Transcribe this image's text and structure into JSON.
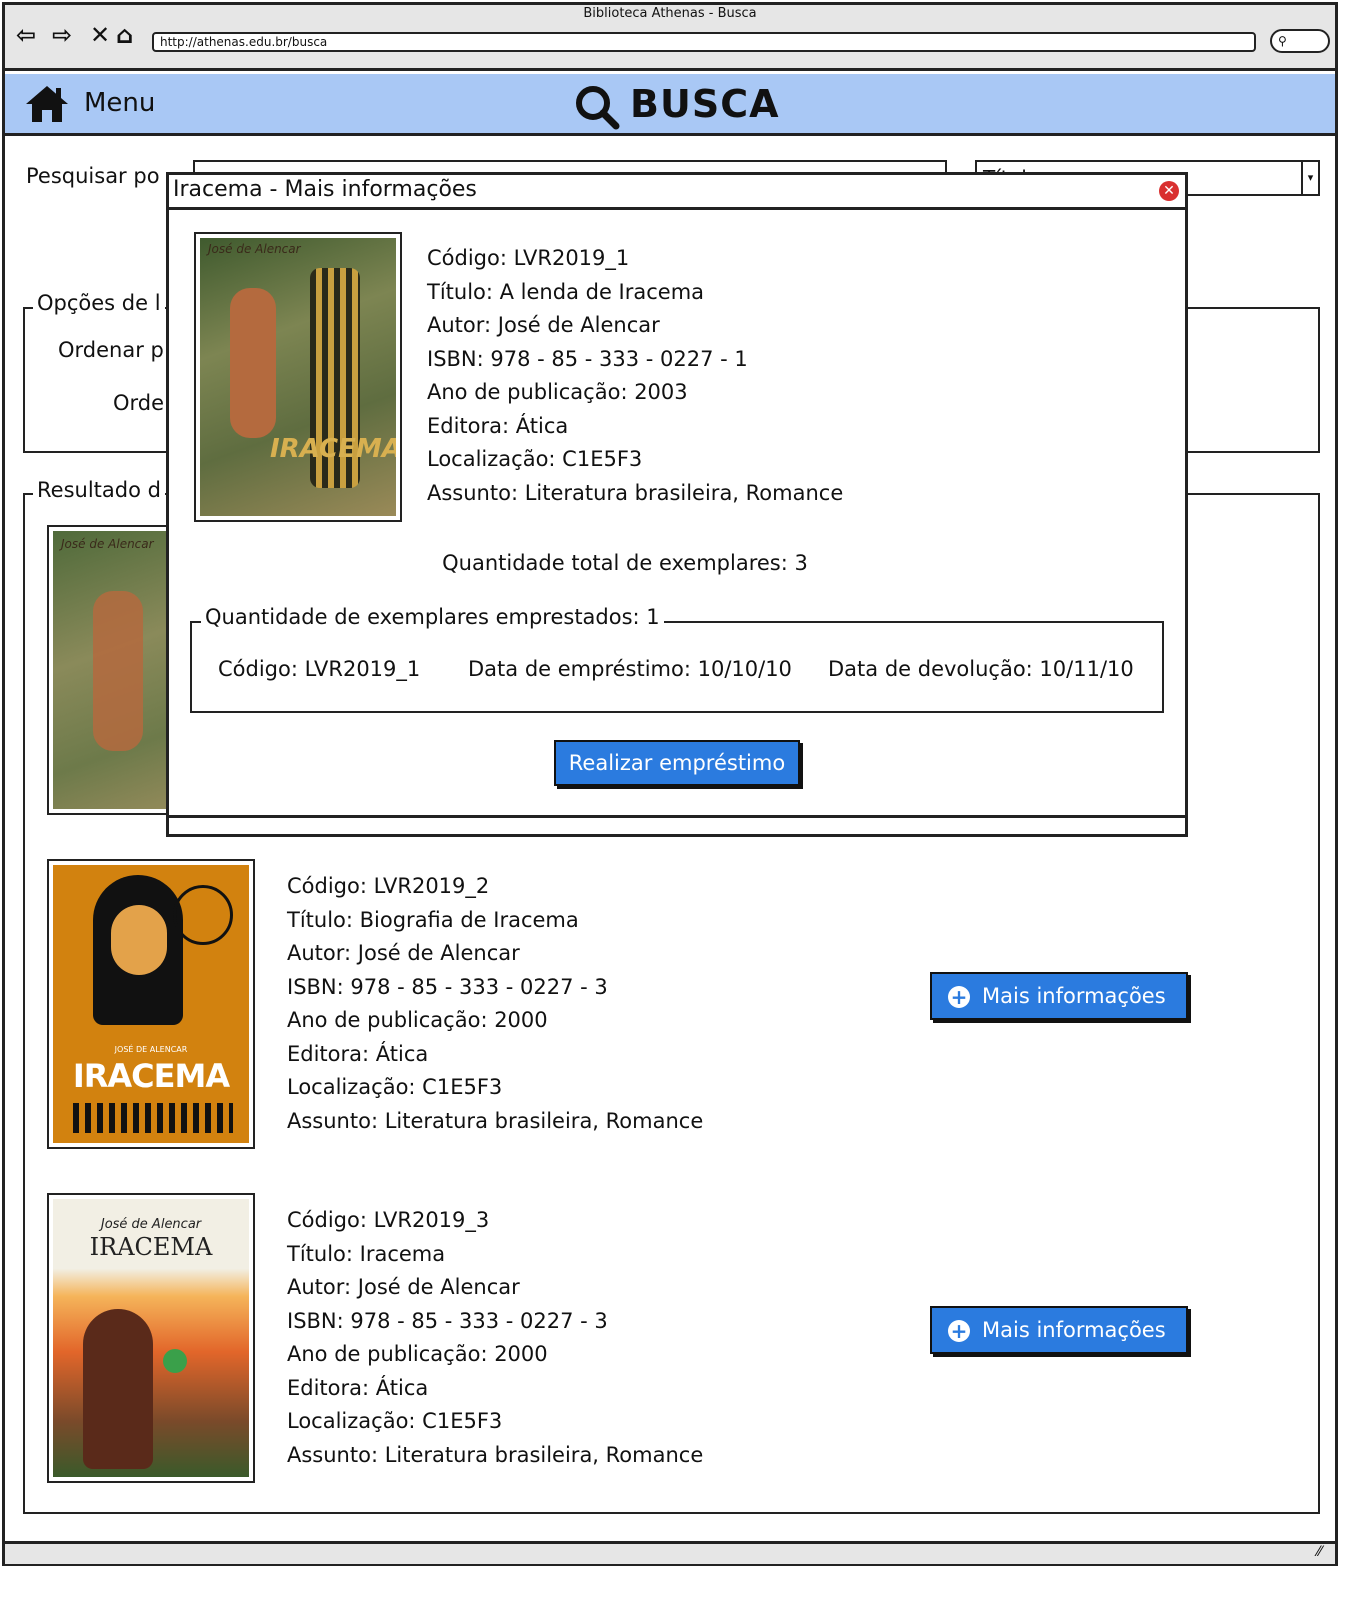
{
  "window": {
    "title": "Biblioteca Athenas - Busca",
    "url": "http://athenas.edu.br/busca"
  },
  "header": {
    "menu_label": "Menu",
    "title": "BUSCA"
  },
  "search": {
    "label": "Pesquisar po",
    "type_value": "Títul"
  },
  "options": {
    "legend": "Opções de l",
    "order_by": "Ordenar p",
    "order": "Orde"
  },
  "results": {
    "legend": "Resultado d",
    "items": [
      {
        "fields": [
          "Código: LVR2019_2",
          "Título: Biografia de Iracema",
          "Autor: José de Alencar",
          "ISBN: 978 - 85 - 333 - 0227 - 3",
          "Ano de publicação: 2000",
          "Editora: Ática",
          "Localização: C1E5F3",
          "Assunto: Literatura brasileira, Romance"
        ],
        "button": "Mais informações",
        "cover_author": "JOSÉ DE ALENCAR",
        "cover_title": "IRACEMA"
      },
      {
        "fields": [
          "Código: LVR2019_3",
          "Título: Iracema",
          "Autor: José de Alencar",
          "ISBN: 978 - 85 - 333 - 0227 - 3",
          "Ano de publicação: 2000",
          "Editora: Ática",
          "Localização: C1E5F3",
          "Assunto: Literatura brasileira, Romance"
        ],
        "button": "Mais informações",
        "cover_author": "José de Alencar",
        "cover_title": "IRACEMA"
      }
    ]
  },
  "modal": {
    "title": "Iracema - Mais informações",
    "fields": [
      "Código: LVR2019_1",
      "Título: A lenda de Iracema",
      "Autor: José de Alencar",
      "ISBN: 978 - 85 - 333 - 0227 - 1",
      "Ano de publicação: 2003",
      "Editora: Ática",
      "Localização: C1E5F3",
      "Assunto: Literatura brasileira, Romance"
    ],
    "cover_author": "José de Alencar",
    "cover_title": "IRACEMA",
    "total_copies": "Quantidade total de exemplares: 3",
    "loaned_legend": "Quantidade de exemplares emprestados: 1",
    "loan": {
      "code": "Código: LVR2019_1",
      "loan_date": "Data de empréstimo: 10/10/10",
      "return_date": "Data de devolução: 10/11/10"
    },
    "button": "Realizar empréstimo"
  },
  "colors": {
    "header": "#a9c8f5",
    "button": "#2b7bdf",
    "close": "#d93030"
  }
}
